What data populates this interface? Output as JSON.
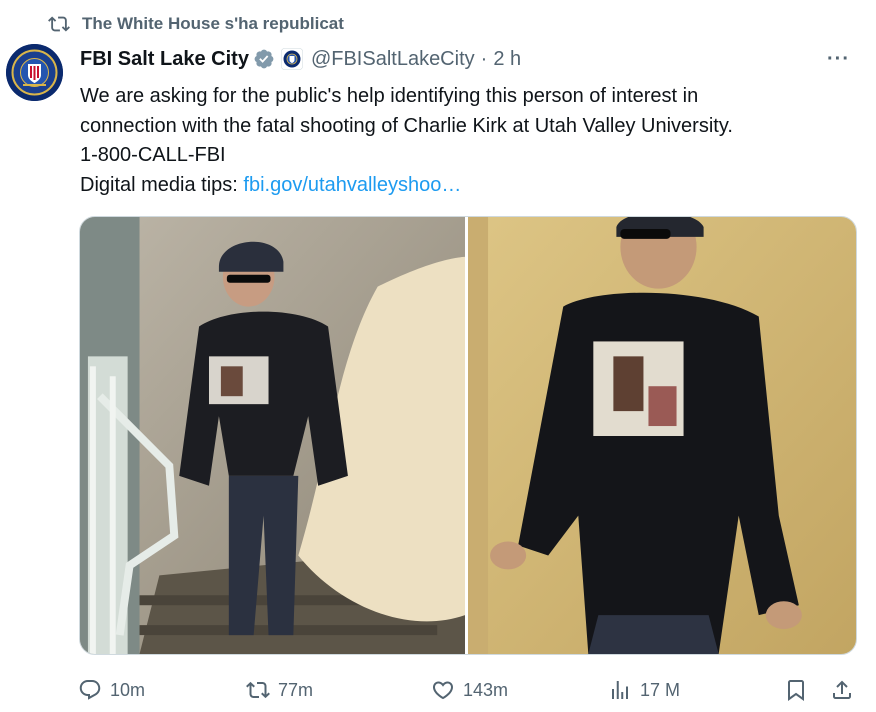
{
  "repost_banner": {
    "text": "The White House s'ha republicat"
  },
  "author": {
    "name": "FBI Salt Lake City",
    "handle": "@FBISaltLakeCity",
    "separator": "·",
    "time": "2 h"
  },
  "more_menu": {
    "label": "···"
  },
  "tweet": {
    "line1": "We are asking for the public's help identifying this person of interest in",
    "line2": "connection with the fatal shooting of Charlie Kirk at Utah Valley University.",
    "line3": "1-800-CALL-FBI",
    "line4_prefix": "Digital media tips: ",
    "link_text": "fbi.gov/utahvalleyshoo…"
  },
  "actions": {
    "replies": "10m",
    "reposts": "77m",
    "likes": "143m",
    "views": "17 M"
  },
  "colors": {
    "accent": "#1d9bf0",
    "muted": "#536471",
    "text": "#0f1419"
  }
}
